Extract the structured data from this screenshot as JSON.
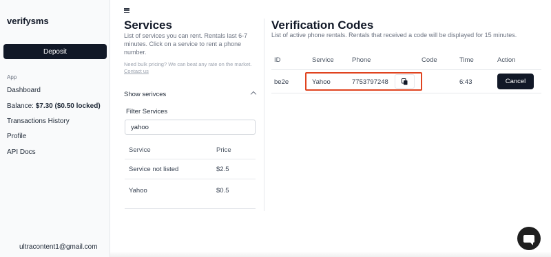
{
  "sidebar": {
    "brand": "verifysms",
    "deposit_label": "Deposit",
    "section_label": "App",
    "items": {
      "dashboard": "Dashboard",
      "balance_label": "Balance:",
      "balance_value": "$7.30 ($0.50 locked)",
      "transactions": "Transactions History",
      "profile": "Profile",
      "api_docs": "API Docs"
    },
    "email": "ultracontent1@gmail.com"
  },
  "services": {
    "title": "Services",
    "description": "List of services you can rent. Rentals last 6-7 minutes. Click on a service to rent a phone number.",
    "bulk_note": "Need bulk pricing? We can beat any rate on the market.",
    "bulk_link": "Contact us",
    "toggle_label": "Show serivces",
    "filter_label": "Filter Services",
    "filter_value": "yahoo",
    "columns": {
      "service": "Service",
      "price": "Price"
    },
    "rows": [
      {
        "service": "Service not listed",
        "price": "$2.5"
      },
      {
        "service": "Yahoo",
        "price": "$0.5"
      }
    ]
  },
  "verification": {
    "title": "Verification Codes",
    "description": "List of active phone rentals. Rentals that received a code will be displayed for 15 minutes.",
    "columns": {
      "id": "ID",
      "service": "Service",
      "phone": "Phone",
      "code": "Code",
      "time": "Time",
      "action": "Action"
    },
    "rows": [
      {
        "id": "be2e",
        "service": "Yahoo",
        "phone": "7753797248",
        "code": "",
        "time": "6:43",
        "action_label": "Cancel"
      }
    ]
  },
  "colors": {
    "accent_dark": "#111827",
    "highlight": "#e0431f"
  },
  "icons": [
    "menu-icon",
    "chevron-up-icon",
    "copy-icon",
    "chat-icon"
  ]
}
